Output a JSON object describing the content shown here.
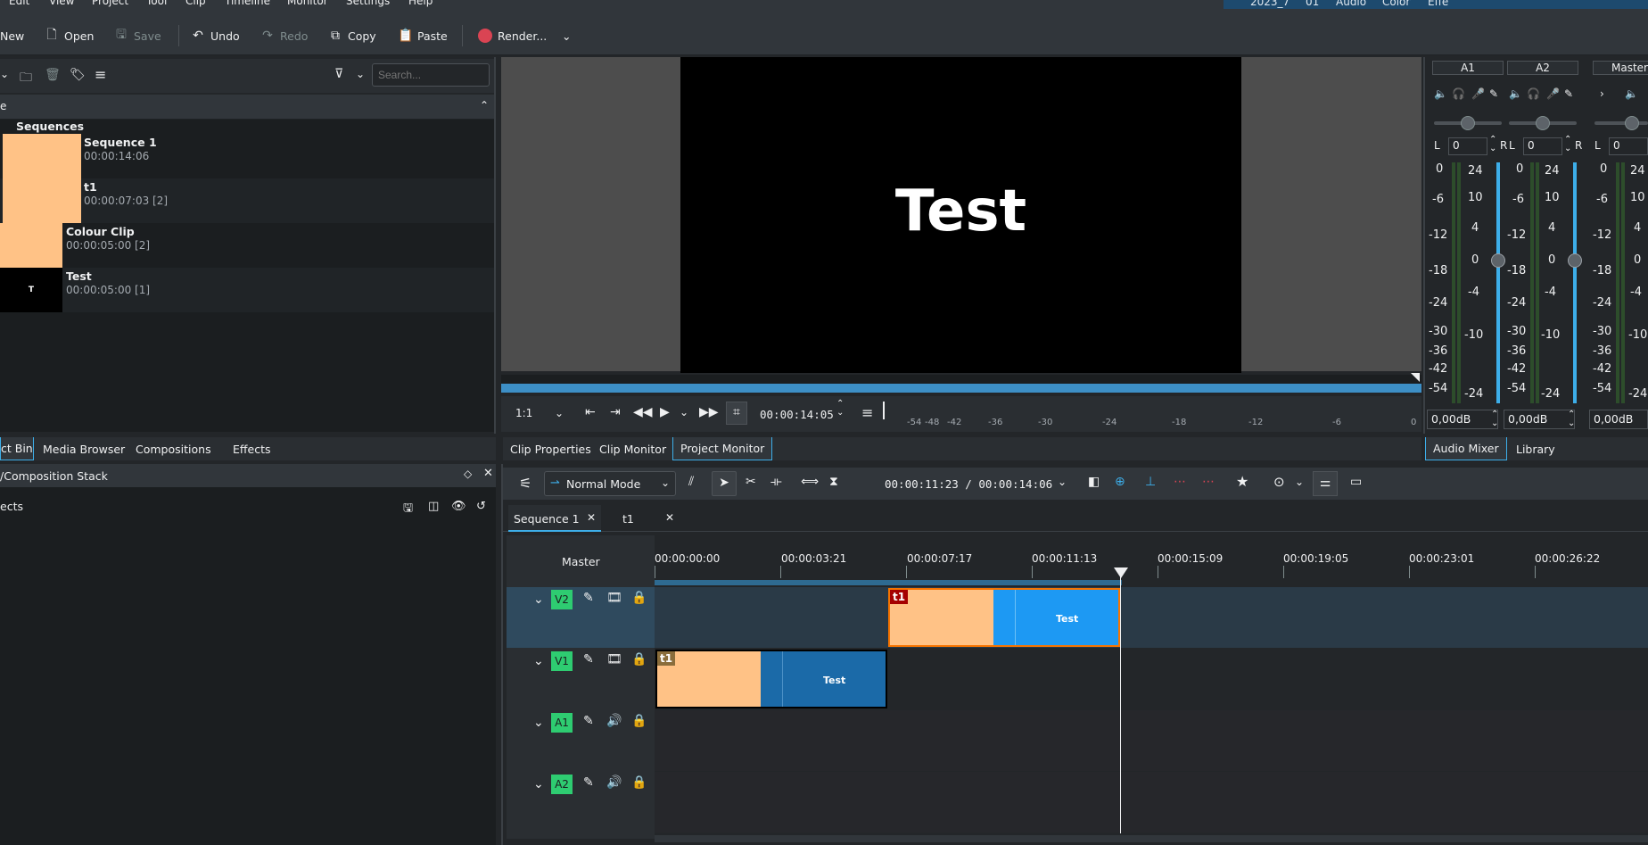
{
  "menubar": {
    "items": [
      "Edit",
      "View",
      "Project",
      "Tool",
      "Clip",
      "Timeline",
      "Monitor",
      "Settings",
      "Help"
    ],
    "layouts": [
      "2023_7",
      "01",
      "Audio",
      "Color",
      "Effe"
    ]
  },
  "toolbar": {
    "new": "New",
    "open": "Open",
    "save": "Save",
    "undo": "Undo",
    "redo": "Redo",
    "copy": "Copy",
    "paste": "Paste",
    "render": "Render..."
  },
  "bin": {
    "search_placeholder": "Search...",
    "header_col": "e",
    "folder": "Sequences",
    "items": [
      {
        "name": "Sequence 1",
        "duration": "00:00:14:06"
      },
      {
        "name": "t1",
        "duration": "00:00:07:03 [2]"
      },
      {
        "name": "Colour Clip",
        "duration": "00:00:05:00 [2]"
      },
      {
        "name": "Test",
        "duration": "00:00:05:00 [1]",
        "thumb_text": "T"
      }
    ],
    "tabs": [
      "ct Bin",
      "Media Browser",
      "Compositions",
      "Effects"
    ]
  },
  "monitor": {
    "video_text": "Test",
    "zoom": "1:1",
    "timecode": "00:00:14:05",
    "audio_scale": [
      "-54",
      "-48",
      "-42",
      "-36",
      "-30",
      "-24",
      "-18",
      "-12",
      "-6",
      "0"
    ],
    "tabs": [
      "Clip Properties",
      "Clip Monitor",
      "Project Monitor"
    ]
  },
  "mixer": {
    "channels": [
      {
        "label": "A1",
        "pan_l": "L",
        "pan_val": "0",
        "pan_r": "R",
        "gain": "0,00dB"
      },
      {
        "label": "A2",
        "pan_l": "L",
        "pan_val": "0",
        "pan_r": "R",
        "gain": "0,00dB"
      },
      {
        "label": "Master",
        "pan_l": "L",
        "pan_val": "0",
        "gain": "0,00dB"
      }
    ],
    "scale_left": [
      "0",
      "-6",
      "-12",
      "-18",
      "-24",
      "-30",
      "-36",
      "-42",
      "-54"
    ],
    "scale_right": [
      "24",
      "10",
      "4",
      "0",
      "-4",
      "-10",
      "-24"
    ],
    "tabs": [
      "Audio Mixer",
      "Library"
    ]
  },
  "effects": {
    "title": "/Composition Stack",
    "subtitle": "ects"
  },
  "timeline": {
    "mode": "Normal Mode",
    "timecode": "00:00:11:23 / 00:00:14:06",
    "tabs": [
      "Sequence 1",
      "t1"
    ],
    "master": "Master",
    "ruler": [
      "00:00:00:00",
      "00:00:03:21",
      "00:00:07:17",
      "00:00:11:13",
      "00:00:15:09",
      "00:00:19:05",
      "00:00:23:01",
      "00:00:26:22"
    ],
    "tracks": [
      "V2",
      "V1",
      "A1",
      "A2"
    ],
    "clips": {
      "v2_t1_label": "t1",
      "v2_test_label": "Test",
      "v1_t1_label": "t1",
      "v1_test_label": "Test"
    }
  }
}
